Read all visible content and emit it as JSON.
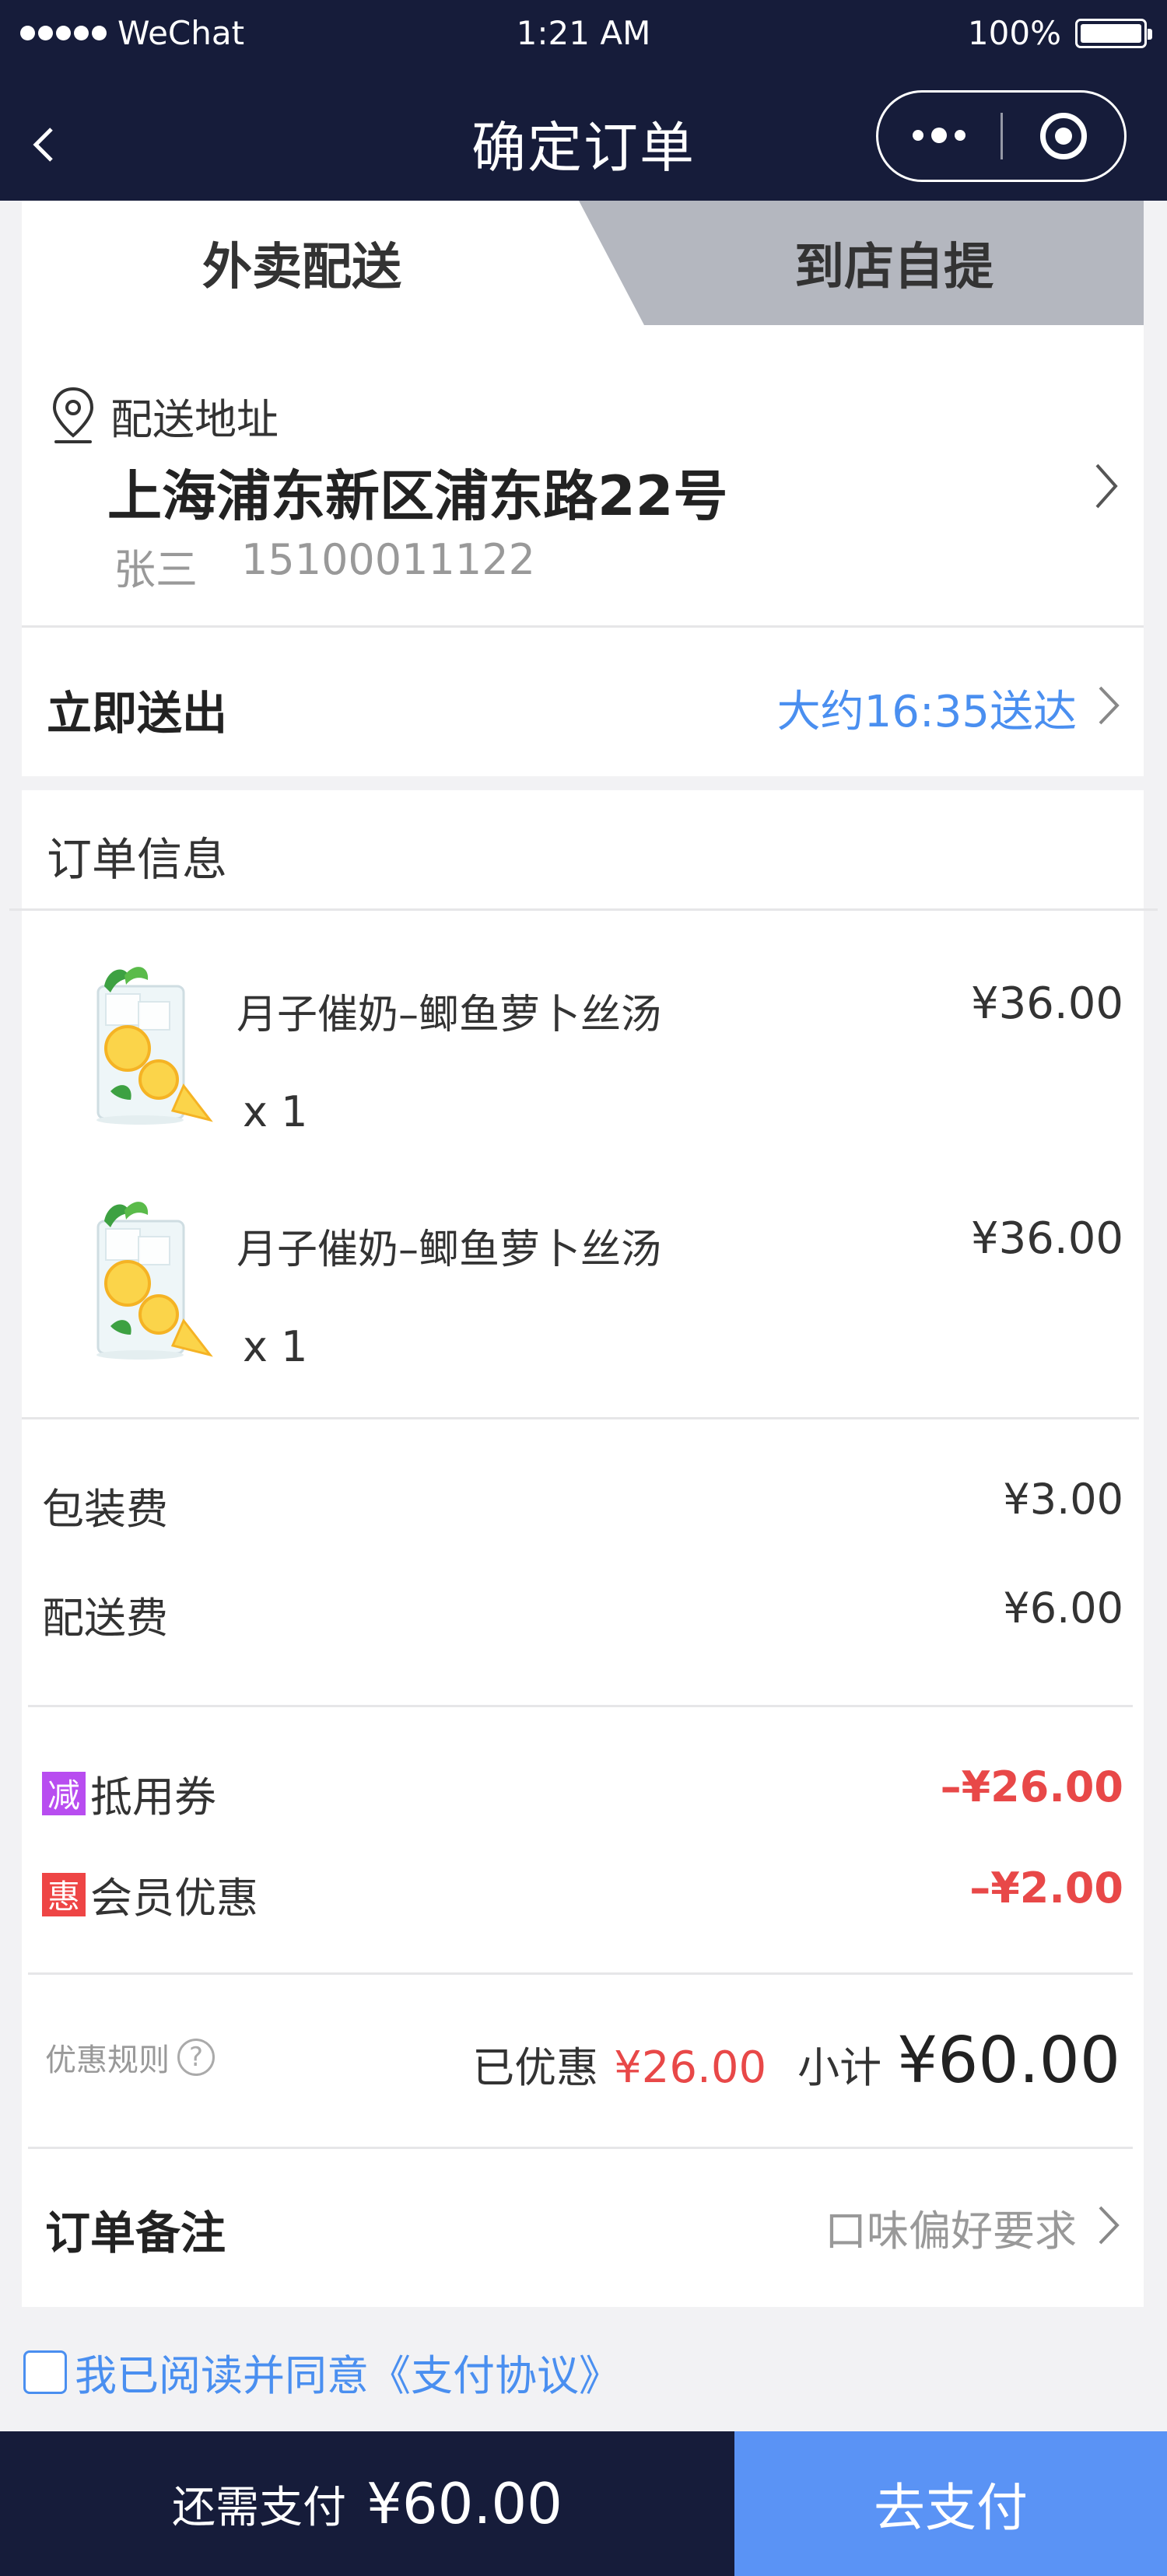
{
  "status_bar": {
    "carrier": "WeChat",
    "time": "1:21 AM",
    "battery": "100%",
    "battery_level": 1.0
  },
  "nav": {
    "title": "确定订单"
  },
  "tabs": [
    {
      "label": "外卖配送",
      "active": true
    },
    {
      "label": "到店自提",
      "active": false
    }
  ],
  "address": {
    "label": "配送地址",
    "main": "上海浦东新区浦东路22号",
    "name": "张三",
    "phone": "15100011122"
  },
  "delivery_time": {
    "label": "立即送出",
    "value": "大约16:35送达"
  },
  "order": {
    "title": "订单信息",
    "items": [
      {
        "name": "月子催奶–鲫鱼萝卜丝汤",
        "qty": "x 1",
        "price": "¥36.00"
      },
      {
        "name": "月子催奶–鲫鱼萝卜丝汤",
        "qty": "x 1",
        "price": "¥36.00"
      }
    ],
    "fees": [
      {
        "label": "包装费",
        "value": "¥3.00"
      },
      {
        "label": "配送费",
        "value": "¥6.00"
      }
    ],
    "discounts": [
      {
        "badge": "减",
        "badge_color": "#b84df0",
        "label": "抵用券",
        "value": "–¥26.00"
      },
      {
        "badge": "惠",
        "badge_color": "#ee4545",
        "label": "会员优惠",
        "value": "–¥2.00"
      }
    ],
    "rule_label": "优惠规则",
    "saved_label": "已优惠",
    "saved_value": "¥26.00",
    "subtotal_label": "小计",
    "subtotal_value": "¥60.00",
    "remark_label": "订单备注",
    "remark_placeholder": "口味偏好要求"
  },
  "agreement": "我已阅读并同意《支付协议》",
  "footer": {
    "pay_label": "还需支付",
    "pay_amount": "¥60.00",
    "pay_button": "去支付"
  },
  "colors": {
    "nav_bg": "#161c3a",
    "accent_blue": "#4a8ff0",
    "pay_button": "#5a93f5",
    "discount_red": "#e84848"
  }
}
